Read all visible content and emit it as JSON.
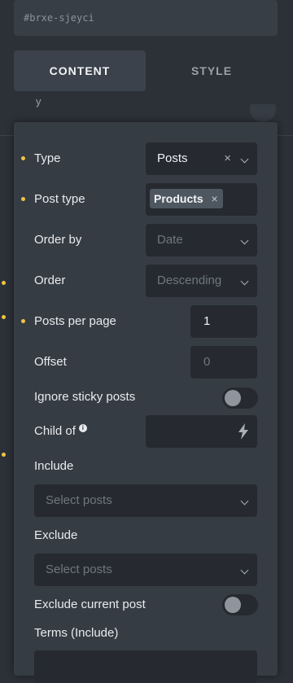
{
  "element_id": "#brxe-sjeyci",
  "tabs": {
    "content": "CONTENT",
    "style": "STYLE"
  },
  "behind_label": "y",
  "colors": {
    "changed_dot": "#f0c541",
    "popup_bg": "#363c44",
    "control_bg": "#262a30"
  },
  "query": {
    "type": {
      "label": "Type",
      "value": "Posts",
      "clear": "×"
    },
    "post_type": {
      "label": "Post type",
      "tag": "Products",
      "tag_remove": "×"
    },
    "order_by": {
      "label": "Order by",
      "value": "Date"
    },
    "order": {
      "label": "Order",
      "value": "Descending"
    },
    "posts_per_page": {
      "label": "Posts per page",
      "value": "1"
    },
    "offset": {
      "label": "Offset",
      "placeholder": "0"
    },
    "ignore_sticky": {
      "label": "Ignore sticky posts",
      "enabled": false
    },
    "child_of": {
      "label": "Child of",
      "info_icon": "info-icon",
      "dynamic_icon": "bolt-icon"
    },
    "include": {
      "label": "Include",
      "placeholder": "Select posts"
    },
    "exclude": {
      "label": "Exclude",
      "placeholder": "Select posts"
    },
    "exclude_current": {
      "label": "Exclude current post",
      "enabled": false
    },
    "terms_include": {
      "label": "Terms (Include)"
    }
  }
}
